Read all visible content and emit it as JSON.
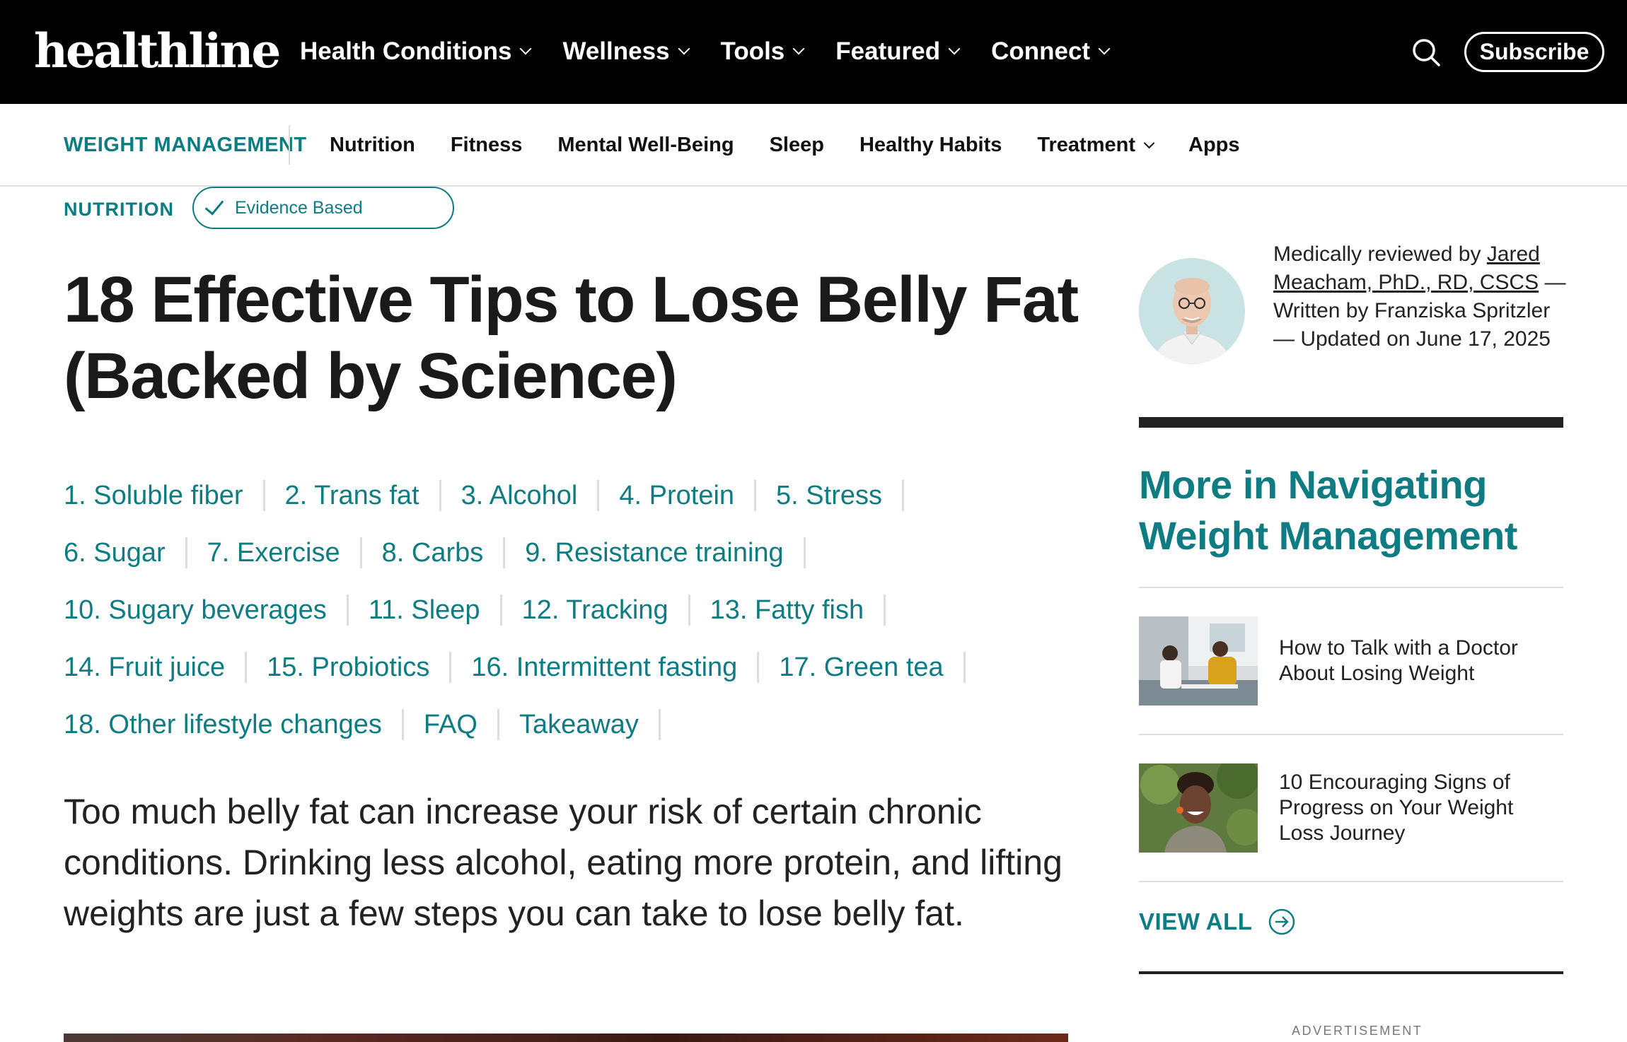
{
  "header": {
    "logo": "healthline",
    "nav": [
      "Health Conditions",
      "Wellness",
      "Tools",
      "Featured",
      "Connect"
    ],
    "subscribe": "Subscribe"
  },
  "subnav": {
    "section": "WEIGHT MANAGEMENT",
    "links": [
      "Nutrition",
      "Fitness",
      "Mental Well-Being",
      "Sleep",
      "Healthy Habits",
      "Treatment",
      "Apps"
    ]
  },
  "article": {
    "category": "NUTRITION",
    "badge": "Evidence Based",
    "title_line1": "18 Effective Tips to Lose Belly Fat",
    "title_line2": "(Backed by Science)",
    "jump_rows": [
      [
        "1. Soluble fiber",
        "2. Trans fat",
        "3. Alcohol",
        "4. Protein",
        "5. Stress"
      ],
      [
        "6. Sugar",
        "7. Exercise",
        "8. Carbs",
        "9. Resistance training"
      ],
      [
        "10. Sugary beverages",
        "11. Sleep",
        "12. Tracking",
        "13. Fatty fish"
      ],
      [
        "14. Fruit juice",
        "15. Probiotics",
        "16. Intermittent fasting",
        "17. Green tea"
      ],
      [
        "18. Other lifestyle changes",
        "FAQ",
        "Takeaway"
      ]
    ],
    "intro": "Too much belly fat can increase your risk of certain chronic conditions. Drinking less alcohol, eating more protein, and lifting weights are just a few steps you can take to lose belly fat."
  },
  "byline": {
    "reviewed_prefix": "Medically reviewed by ",
    "reviewer": "Jared Meacham, PhD., RD, CSCS",
    "rest": " — Written by Franziska Spritzler — Updated on June 17, 2025"
  },
  "sidebar": {
    "title": "More in Navigating Weight Management",
    "items": [
      "How to Talk with a Doctor About Losing Weight",
      "10 Encouraging Signs of Progress on Your Weight Loss Journey"
    ],
    "view_all": "VIEW ALL",
    "advertisement": "ADVERTISEMENT"
  },
  "colors": {
    "accent": "#0e7c82",
    "header_bg": "#000000"
  }
}
